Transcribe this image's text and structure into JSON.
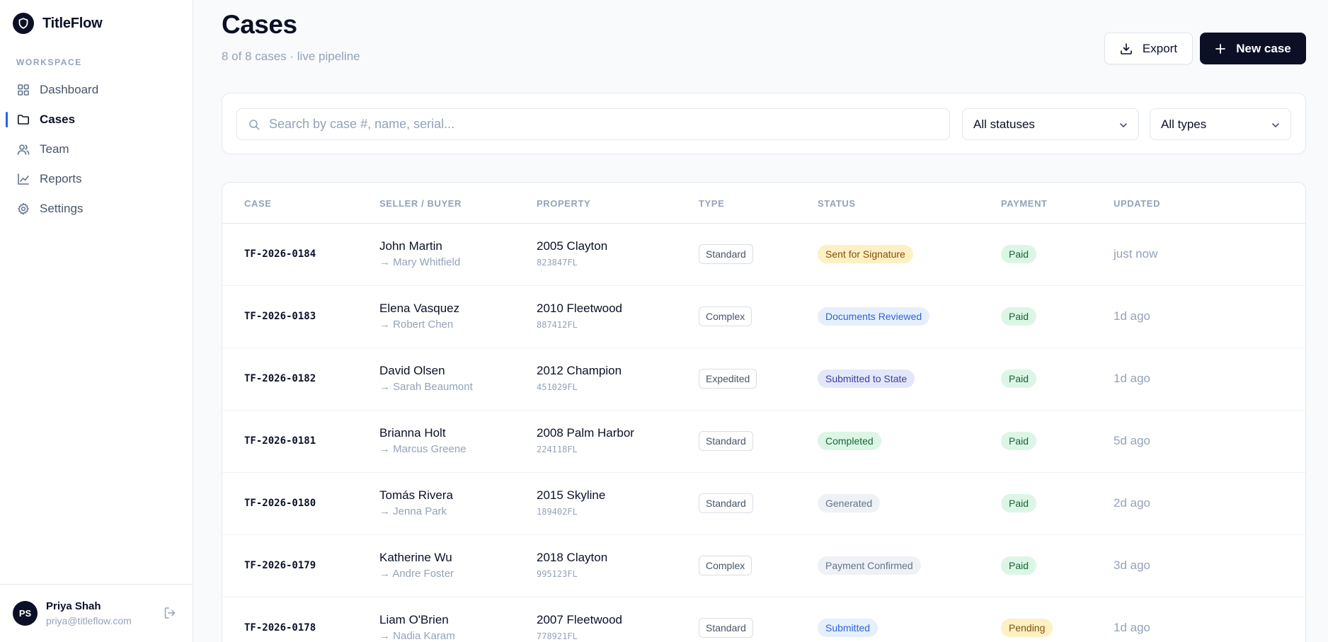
{
  "app": {
    "name": "TitleFlow"
  },
  "sidebar": {
    "section_label": "WORKSPACE",
    "items": [
      {
        "label": "Dashboard",
        "icon": "grid-icon",
        "active": false
      },
      {
        "label": "Cases",
        "icon": "folder-icon",
        "active": true
      },
      {
        "label": "Team",
        "icon": "users-icon",
        "active": false
      },
      {
        "label": "Reports",
        "icon": "chart-line-icon",
        "active": false
      },
      {
        "label": "Settings",
        "icon": "gear-icon",
        "active": false
      }
    ],
    "user": {
      "initials": "PS",
      "name": "Priya Shah",
      "email": "priya@titleflow.com"
    }
  },
  "header": {
    "title": "Cases",
    "subtitle": "8 of 8 cases · live pipeline",
    "export_label": "Export",
    "new_label": "New case"
  },
  "filters": {
    "search_placeholder": "Search by case #, name, serial...",
    "status_value": "All statuses",
    "type_value": "All types"
  },
  "table": {
    "columns": [
      "CASE",
      "SELLER / BUYER",
      "PROPERTY",
      "TYPE",
      "STATUS",
      "PAYMENT",
      "UPDATED"
    ],
    "rows": [
      {
        "case": "TF-2026-0184",
        "seller": "John Martin",
        "buyer": "→ Mary Whitfield",
        "property": "2005 Clayton",
        "serial": "823847FL",
        "type": "Standard",
        "status": "Sent for Signature",
        "status_kind": "yellow",
        "payment": "Paid",
        "payment_kind": "green",
        "updated": "just now"
      },
      {
        "case": "TF-2026-0183",
        "seller": "Elena Vasquez",
        "buyer": "→ Robert Chen",
        "property": "2010 Fleetwood",
        "serial": "887412FL",
        "type": "Complex",
        "status": "Documents Reviewed",
        "status_kind": "blue",
        "payment": "Paid",
        "payment_kind": "green",
        "updated": "1d ago"
      },
      {
        "case": "TF-2026-0182",
        "seller": "David Olsen",
        "buyer": "→ Sarah Beaumont",
        "property": "2012 Champion",
        "serial": "451029FL",
        "type": "Expedited",
        "status": "Submitted to State",
        "status_kind": "indigo",
        "payment": "Paid",
        "payment_kind": "green",
        "updated": "1d ago"
      },
      {
        "case": "TF-2026-0181",
        "seller": "Brianna Holt",
        "buyer": "→ Marcus Greene",
        "property": "2008 Palm Harbor",
        "serial": "224118FL",
        "type": "Standard",
        "status": "Completed",
        "status_kind": "green",
        "payment": "Paid",
        "payment_kind": "green",
        "updated": "5d ago"
      },
      {
        "case": "TF-2026-0180",
        "seller": "Tomás Rivera",
        "buyer": "→ Jenna Park",
        "property": "2015 Skyline",
        "serial": "189402FL",
        "type": "Standard",
        "status": "Generated",
        "status_kind": "gray",
        "payment": "Paid",
        "payment_kind": "green",
        "updated": "2d ago"
      },
      {
        "case": "TF-2026-0179",
        "seller": "Katherine Wu",
        "buyer": "→ Andre Foster",
        "property": "2018 Clayton",
        "serial": "995123FL",
        "type": "Complex",
        "status": "Payment Confirmed",
        "status_kind": "gray",
        "payment": "Paid",
        "payment_kind": "green",
        "updated": "3d ago"
      },
      {
        "case": "TF-2026-0178",
        "seller": "Liam O'Brien",
        "buyer": "→ Nadia Karam",
        "property": "2007 Fleetwood",
        "serial": "778921FL",
        "type": "Standard",
        "status": "Submitted",
        "status_kind": "blue",
        "payment": "Pending",
        "payment_kind": "yellow",
        "updated": "1d ago"
      }
    ]
  },
  "colors": {
    "brand": "#0b1026",
    "accent": "#2563eb",
    "pill_yellow": {
      "bg": "#fdf0c2",
      "fg": "#854d0e"
    },
    "pill_blue": {
      "bg": "#e6effe",
      "fg": "#2f64d6"
    },
    "pill_indigo": {
      "bg": "#e3e7fb",
      "fg": "#3b3f9e"
    },
    "pill_green": {
      "bg": "#dcf6e6",
      "fg": "#166534"
    },
    "pill_gray": {
      "bg": "#eef1f5",
      "fg": "#64748b"
    }
  }
}
